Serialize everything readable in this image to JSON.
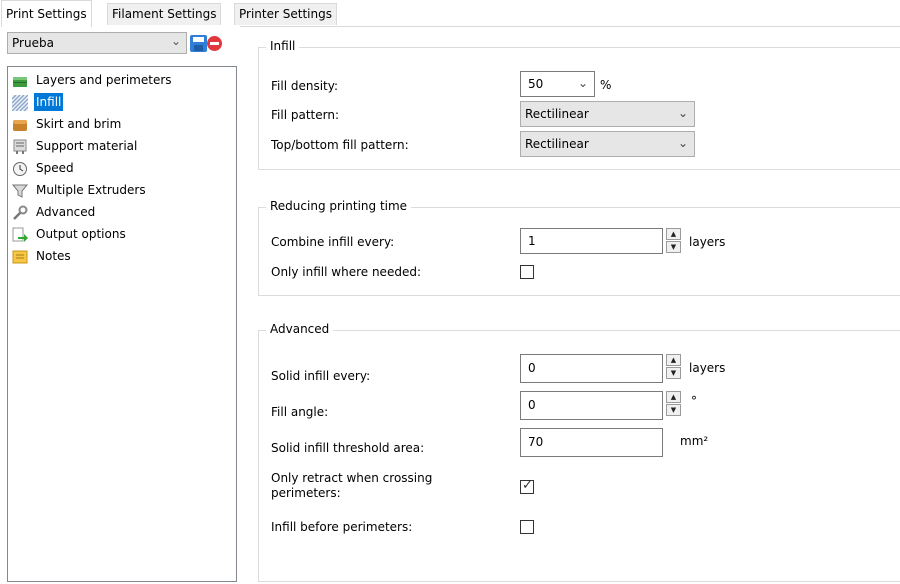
{
  "tabs": [
    "Print Settings",
    "Filament Settings",
    "Printer Settings"
  ],
  "preset": {
    "value": "Prueba"
  },
  "tree": [
    {
      "label": "Layers and perimeters",
      "icon": "layers-icon"
    },
    {
      "label": "Infill",
      "icon": "infill-icon",
      "selected": true
    },
    {
      "label": "Skirt and brim",
      "icon": "skirt-brim-icon"
    },
    {
      "label": "Support material",
      "icon": "support-material-icon"
    },
    {
      "label": "Speed",
      "icon": "speed-clock-icon"
    },
    {
      "label": "Multiple Extruders",
      "icon": "funnel-icon"
    },
    {
      "label": "Advanced",
      "icon": "wrench-icon"
    },
    {
      "label": "Output options",
      "icon": "output-arrow-icon"
    },
    {
      "label": "Notes",
      "icon": "notes-icon"
    }
  ],
  "infill": {
    "title": "Infill",
    "fill_density_label": "Fill density:",
    "fill_density_value": "50",
    "fill_density_unit": "%",
    "fill_pattern_label": "Fill pattern:",
    "fill_pattern_value": "Rectilinear",
    "top_bottom_label": "Top/bottom fill pattern:",
    "top_bottom_value": "Rectilinear"
  },
  "reducing": {
    "title": "Reducing printing time",
    "combine_label": "Combine infill every:",
    "combine_value": "1",
    "combine_unit": "layers",
    "only_infill_label": "Only infill where needed:",
    "only_infill_checked": false
  },
  "advanced": {
    "title": "Advanced",
    "solid_every_label": "Solid infill every:",
    "solid_every_value": "0",
    "solid_every_unit": "layers",
    "fill_angle_label": "Fill angle:",
    "fill_angle_value": "0",
    "fill_angle_unit": "°",
    "threshold_label": "Solid infill threshold area:",
    "threshold_value": "70",
    "threshold_unit": "mm²",
    "retract_label_line1": "Only retract when crossing",
    "retract_label_line2": "perimeters:",
    "retract_checked": true,
    "before_label": "Infill before perimeters:",
    "before_checked": false
  },
  "colors": {
    "selection": "#0078d7",
    "delete": "#e0383e",
    "save": "#2f7fd8"
  }
}
